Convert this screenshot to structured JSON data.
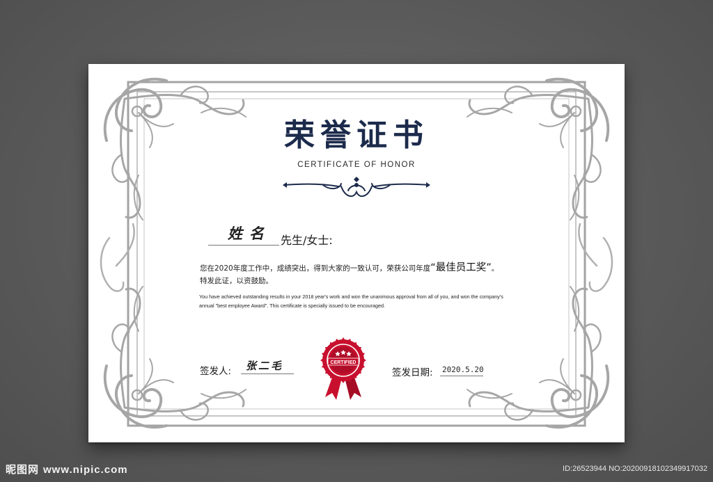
{
  "certificate": {
    "title": "荣誉证书",
    "subtitle": "CERTIFICATE OF HONOR",
    "recipient_name": "姓名",
    "salutation": "先生/女士:",
    "body_zh_prefix": "您在2020年度工作中，成绩突出，得到大家的一致认可，荣获公司年度",
    "award_name": "“最佳员工奖”",
    "body_zh_period": "。",
    "body_zh_line2": "特发此证，以资鼓励。",
    "body_en_line1": "You have achieved outstanding results in your 2018 year's work and won the unanimous approval from all of you, and won the company's",
    "body_en_line2": "annual \"best employee Award\". This certificate is specially issued to be encouraged.",
    "issuer_label": "签发人:",
    "issuer_signature": "张二毛",
    "date_label": "签发日期:",
    "date_value": "2020.5.20",
    "seal_text": "CERTIFIED"
  },
  "footer": {
    "site_name": "昵图网",
    "site_url": "www.nipic.com",
    "id_text": "ID:26523944 NO:20200918102349917032"
  },
  "colors": {
    "background": "#595959",
    "title": "#1c2a4b",
    "frame": "#9a9a9a",
    "seal_red": "#c8102e"
  }
}
